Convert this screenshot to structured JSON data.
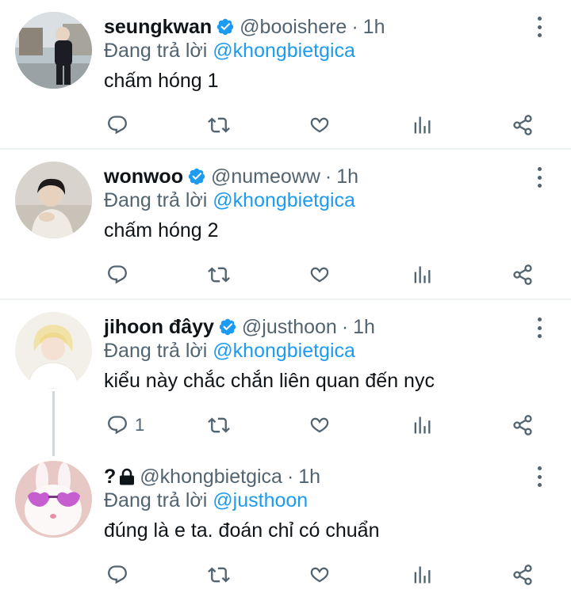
{
  "colors": {
    "link": "#1d9bf0",
    "muted": "#536471",
    "text": "#0f1419",
    "verified": "#1d9bf0"
  },
  "tweets": [
    {
      "name": "seungkwan",
      "verified": true,
      "handle": "@booishere",
      "sep": "·",
      "time": "1h",
      "reply_prefix": "Đang trả lời ",
      "reply_to": "@khongbietgica",
      "text": "chấm hóng 1",
      "reply_count": ""
    },
    {
      "name": "wonwoo",
      "verified": true,
      "handle": "@numeoww",
      "sep": "·",
      "time": "1h",
      "reply_prefix": "Đang trả lời ",
      "reply_to": "@khongbietgica",
      "text": "chấm hóng 2",
      "reply_count": ""
    },
    {
      "name": "jihoon đâyy",
      "verified": true,
      "handle": "@justhoon",
      "sep": "·",
      "time": "1h",
      "reply_prefix": "Đang trả lời ",
      "reply_to": "@khongbietgica",
      "text": "kiểu này chắc chắn liên quan đến nyc",
      "reply_count": "1"
    },
    {
      "name": "?",
      "verified": false,
      "locked": true,
      "handle": "@khongbietgica",
      "sep": "·",
      "time": "1h",
      "reply_prefix": "Đang trả lời ",
      "reply_to": "@justhoon",
      "text": "đúng là e ta. đoán chỉ có chuẩn",
      "reply_count": ""
    }
  ],
  "icons": [
    "reply-icon",
    "retweet-icon",
    "like-icon",
    "analytics-icon",
    "share-icon",
    "more-icon",
    "verified-badge-icon",
    "lock-icon"
  ]
}
